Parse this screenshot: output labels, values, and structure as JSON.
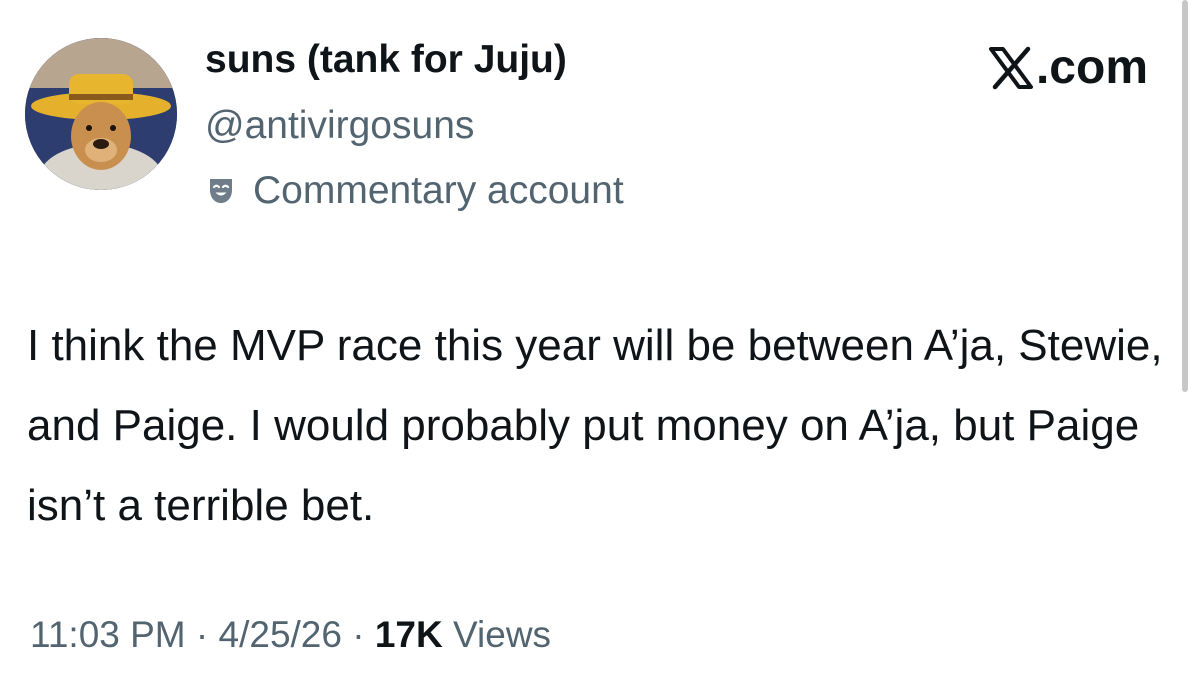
{
  "tweet": {
    "display_name": "suns (tank for Juju)",
    "handle": "@antivirgosuns",
    "account_label": "Commentary account",
    "account_label_icon": "theater-mask-icon",
    "brand": ".com",
    "brand_icon": "x-logo-icon",
    "body": "I think the MVP race this year will be between A’ja, Stewie, and Paige. I would probably put money on A’ja, but Paige isn’t a terrible bet.",
    "time": "11:03 PM",
    "date": "4/25/26",
    "separator": "·",
    "views_count": "17K",
    "views_label": "Views"
  },
  "colors": {
    "primary_text": "#0f1419",
    "secondary_text": "#536471",
    "background": "#ffffff"
  }
}
